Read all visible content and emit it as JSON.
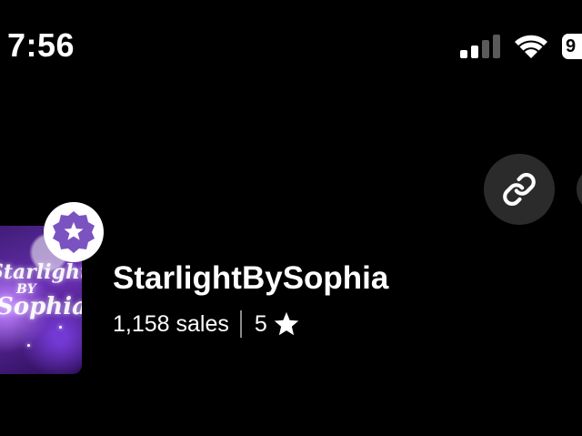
{
  "status_bar": {
    "time": "7:56",
    "battery_level": "9"
  },
  "shop": {
    "name": "StarlightBySophia",
    "sales": "1,158 sales",
    "rating": "5"
  },
  "avatar": {
    "text_line1": "Starlight",
    "text_line2": "BY",
    "text_line3": "Sophia"
  },
  "colors": {
    "background": "#000000",
    "button_bg": "#2b2b2b",
    "badge_purple": "#7b53c1"
  },
  "icons": {
    "link_button": "link-icon",
    "badge": "star-seller-icon",
    "rating": "star-icon"
  }
}
